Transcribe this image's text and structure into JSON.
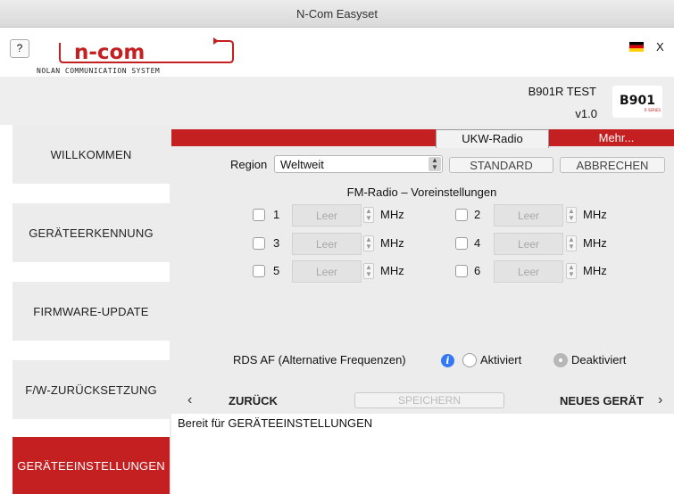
{
  "window": {
    "title": "N-Com Easyset"
  },
  "header": {
    "help_label": "?",
    "logo_text": "n-com",
    "logo_tagline": "NOLAN COMMUNICATION SYSTEM",
    "language_flag": "german-flag",
    "close_label": "X"
  },
  "device": {
    "name": "B901R TEST",
    "version": "v1.0",
    "badge": "B901",
    "badge_sub": "R SERIES"
  },
  "sidebar": {
    "items": [
      {
        "label": "WILLKOMMEN",
        "active": false
      },
      {
        "label": "GERÄTEERKENNUNG",
        "active": false
      },
      {
        "label": "FIRMWARE-UPDATE",
        "active": false
      },
      {
        "label": "F/W-ZURÜCKSETZUNG",
        "active": false
      },
      {
        "label": "GERÄTEEINSTELLUNGEN",
        "active": true
      }
    ]
  },
  "tabs": [
    {
      "label": "UKW-Radio",
      "active": true
    },
    {
      "label": "Mehr...",
      "active": false
    }
  ],
  "region": {
    "label": "Region",
    "value": "Weltweit"
  },
  "buttons": {
    "standard": "STANDARD",
    "cancel": "ABBRECHEN"
  },
  "presets": {
    "title": "FM-Radio – Voreinstellungen",
    "placeholder": "Leer",
    "unit": "MHz",
    "items": [
      {
        "num": "1"
      },
      {
        "num": "2"
      },
      {
        "num": "3"
      },
      {
        "num": "4"
      },
      {
        "num": "5"
      },
      {
        "num": "6"
      }
    ]
  },
  "rds": {
    "label": "RDS AF (Alternative Frequenzen)",
    "option_on": "Aktiviert",
    "option_off": "Deaktiviert",
    "selected": "Deaktiviert"
  },
  "footer_nav": {
    "back": "ZURÜCK",
    "save": "SPEICHERN",
    "next": "NEUES GERÄT"
  },
  "status": {
    "text": "Bereit für GERÄTEEINSTELLUNGEN"
  },
  "colors": {
    "accent": "#c42021",
    "info": "#3478f6"
  }
}
